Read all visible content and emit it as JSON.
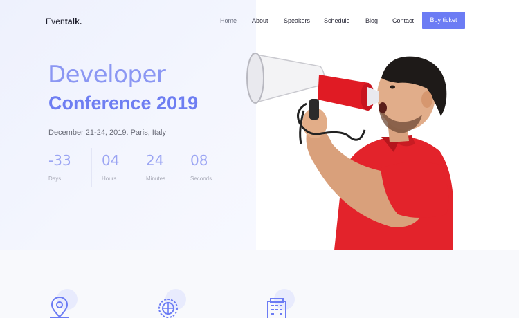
{
  "brand": {
    "name_light": "Even",
    "name_bold": "talk."
  },
  "nav": {
    "items": [
      {
        "label": "Home"
      },
      {
        "label": "About"
      },
      {
        "label": "Speakers"
      },
      {
        "label": "Schedule"
      },
      {
        "label": "Blog"
      },
      {
        "label": "Contact"
      }
    ],
    "cta": "Buy ticket"
  },
  "hero": {
    "title_line1": "Developer",
    "title_line2": "Conference 2019",
    "date_location": "December 21-24, 2019. Paris, Italy",
    "countdown": [
      {
        "value": "-33",
        "unit": "Days"
      },
      {
        "value": "04",
        "unit": "Hours"
      },
      {
        "value": "24",
        "unit": "Minutes"
      },
      {
        "value": "08",
        "unit": "Seconds"
      }
    ]
  },
  "colors": {
    "accent": "#6c7cf4",
    "hero_bg": "#eef1fd",
    "shirt": "#e3232b"
  },
  "icons": [
    "location-pin-icon",
    "globe-icon",
    "building-icon"
  ]
}
